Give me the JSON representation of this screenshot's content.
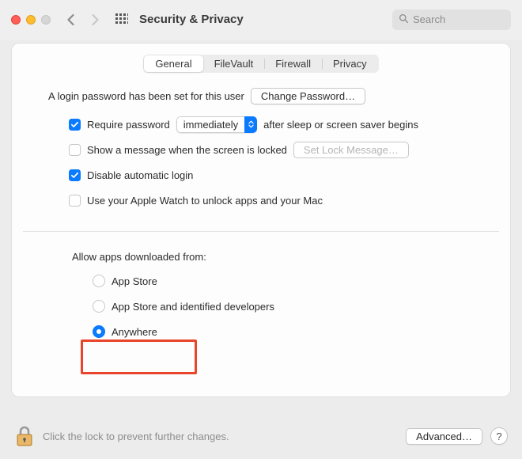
{
  "window": {
    "title": "Security & Privacy"
  },
  "search": {
    "placeholder": "Search",
    "value": ""
  },
  "tabs": {
    "general": "General",
    "filevault": "FileVault",
    "firewall": "Firewall",
    "privacy": "Privacy",
    "active": "general"
  },
  "login_section": {
    "password_set_text": "A login password has been set for this user",
    "change_password_btn": "Change Password…",
    "require_pw_label_pre": "Require password",
    "require_pw_select_value": "immediately",
    "require_pw_label_post": "after sleep or screen saver begins",
    "require_pw_checked": true,
    "show_message_label": "Show a message when the screen is locked",
    "show_message_checked": false,
    "set_lock_msg_btn": "Set Lock Message…",
    "disable_autologin_label": "Disable automatic login",
    "disable_autologin_checked": true,
    "apple_watch_label": "Use your Apple Watch to unlock apps and your Mac",
    "apple_watch_checked": false
  },
  "allow_section": {
    "heading": "Allow apps downloaded from:",
    "opt_appstore": "App Store",
    "opt_identified": "App Store and identified developers",
    "opt_anywhere": "Anywhere",
    "selected": "anywhere"
  },
  "footer": {
    "lock_text": "Click the lock to prevent further changes.",
    "advanced_btn": "Advanced…",
    "help": "?"
  },
  "colors": {
    "accent": "#0a7aff",
    "highlight": "#e9452a"
  }
}
